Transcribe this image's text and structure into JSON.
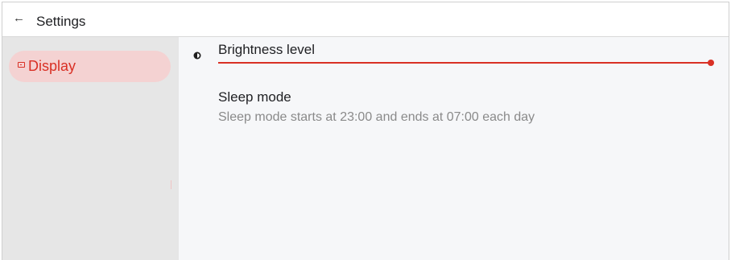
{
  "header": {
    "back_icon": "arrow-back-icon",
    "back_glyph": "←",
    "title": "Settings"
  },
  "sidebar": {
    "items": [
      {
        "label": "Display",
        "icon": "display-icon",
        "selected": true
      }
    ]
  },
  "display": {
    "brightness": {
      "icon": "brightness-icon",
      "label": "Brightness level",
      "value_fraction": 1.0
    },
    "sleep": {
      "icon": "moon-icon",
      "label": "Sleep mode",
      "description": "Sleep mode starts at 23:00 and ends at 07:00 each day"
    }
  },
  "colors": {
    "accent": "#d93025",
    "selected_bg": "#f4d2d2",
    "sidebar_bg": "#e6e6e6",
    "content_bg": "#f6f7f9",
    "secondary_text": "#8a8a8a"
  }
}
